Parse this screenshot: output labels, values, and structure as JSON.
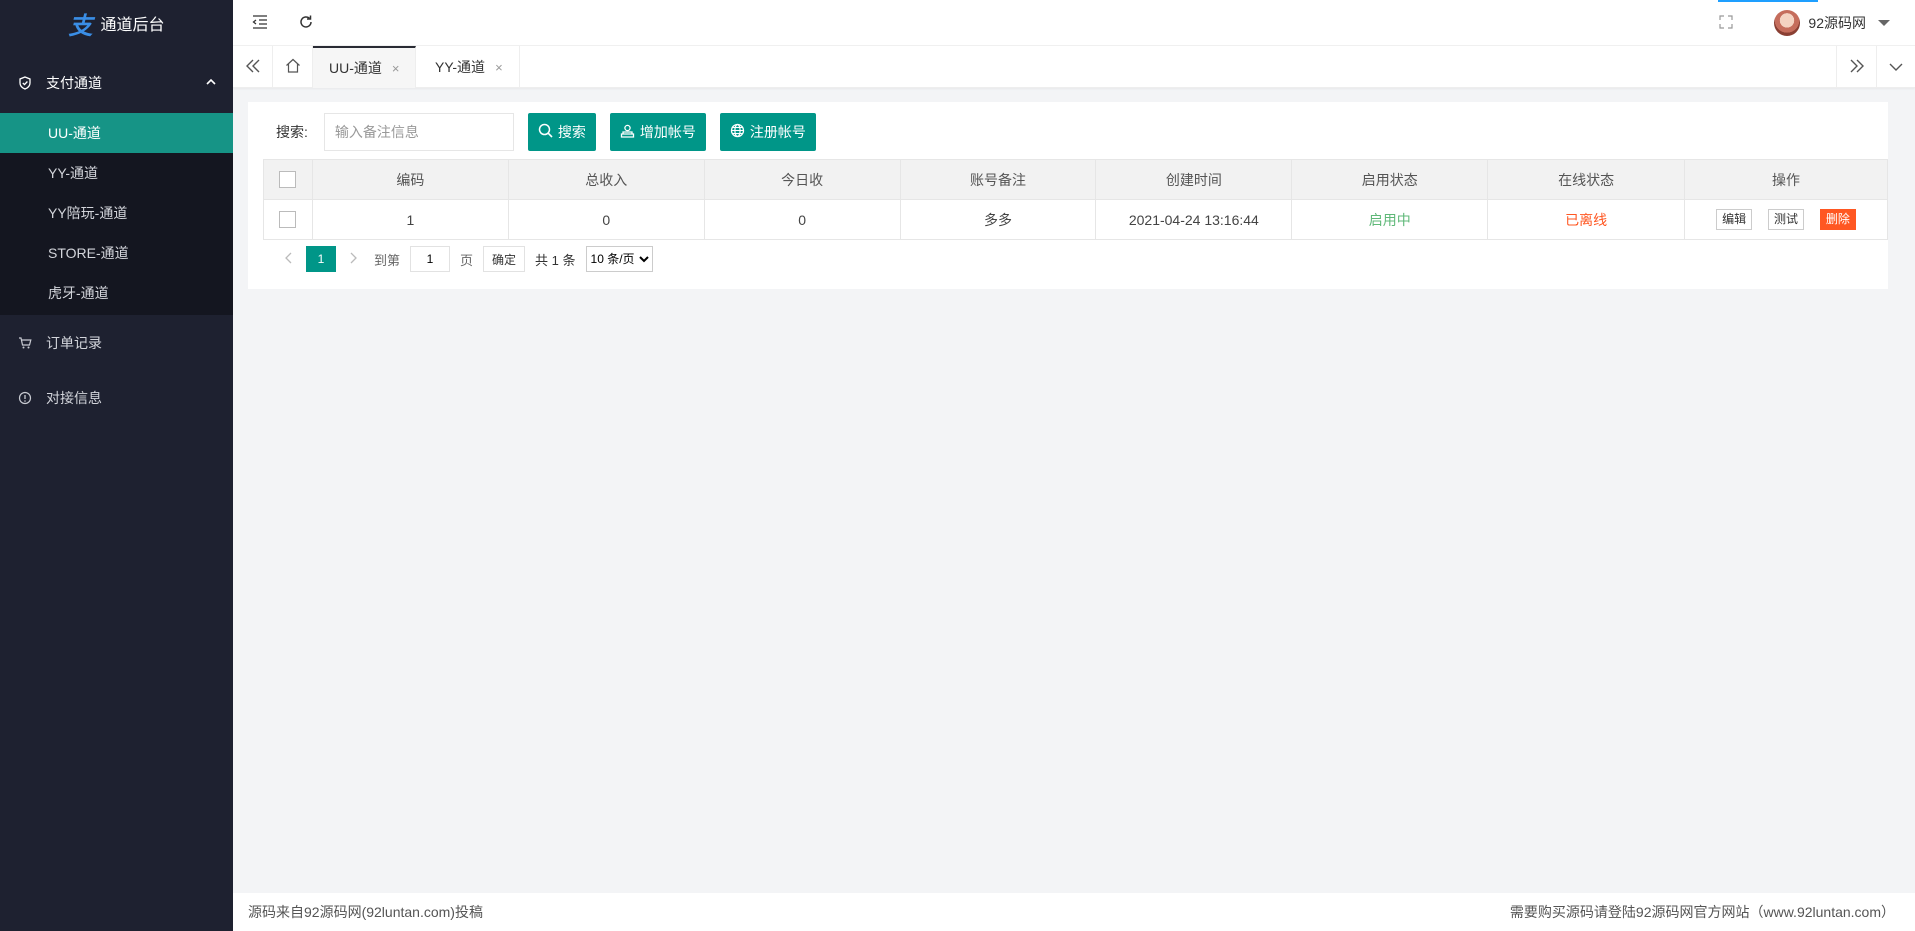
{
  "app": {
    "title": "通道后台",
    "logo_glyph": "支"
  },
  "sidebar": {
    "group": {
      "label": "支付通道",
      "icon": "shield-check-icon",
      "expanded": true
    },
    "subitems": [
      {
        "label": "UU-通道",
        "active": true
      },
      {
        "label": "YY-通道",
        "active": false
      },
      {
        "label": "YY陪玩-通道",
        "active": false
      },
      {
        "label": "STORE-通道",
        "active": false
      },
      {
        "label": "虎牙-通道",
        "active": false
      }
    ],
    "items": [
      {
        "label": "订单记录",
        "icon": "cart-icon"
      },
      {
        "label": "对接信息",
        "icon": "info-icon"
      }
    ]
  },
  "header": {
    "user_name": "92源码网"
  },
  "tabs": [
    {
      "label": "UU-通道",
      "close": "×",
      "active": true
    },
    {
      "label": "YY-通道",
      "close": "×",
      "active": false
    }
  ],
  "toolbar": {
    "search_label": "搜索:",
    "search_placeholder": "输入备注信息",
    "search_button": "搜索",
    "add_button": "增加帐号",
    "register_button": "注册帐号"
  },
  "table": {
    "columns": [
      "编码",
      "总收入",
      "今日收",
      "账号备注",
      "创建时间",
      "启用状态",
      "在线状态",
      "操作"
    ],
    "rows": [
      {
        "code": "1",
        "total": "0",
        "today": "0",
        "remark": "多多",
        "created": "2021-04-24 13:16:44",
        "enabled": "启用中",
        "online": "已离线"
      }
    ],
    "actions": {
      "edit": "编辑",
      "test": "测试",
      "delete": "删除"
    }
  },
  "pager": {
    "current": "1",
    "goto_label": "到第",
    "goto_value": "1",
    "page_unit": "页",
    "confirm": "确定",
    "total": "共 1 条",
    "page_size": "10 条/页"
  },
  "footer": {
    "left": "源码来自92源码网(92luntan.com)投稿",
    "right": "需要购买源码请登陆92源码网官方网站（www.92luntan.com）"
  },
  "colors": {
    "accent": "#009688",
    "sidebar": "#1e2130",
    "active_item": "#169486",
    "enabled": "#5fb878",
    "offline": "#ff5722"
  }
}
